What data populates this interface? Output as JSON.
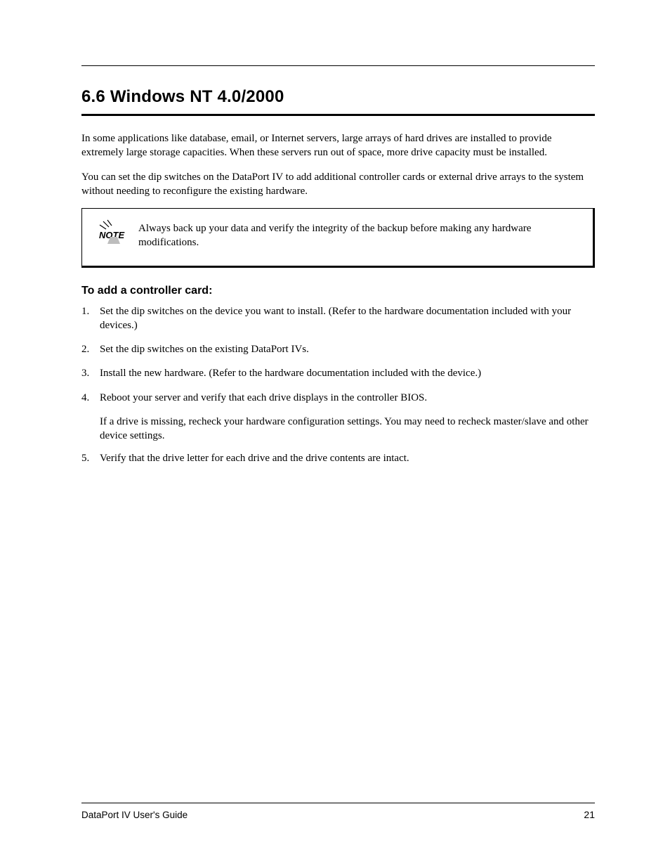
{
  "header": {
    "sectionNumber": "6.6",
    "sectionTitle": "Windows NT 4.0/2000"
  },
  "body": {
    "intro": "In some applications like database, email, or Internet servers, large arrays of hard drives are installed to provide extremely large storage capacities. When these servers run out of space, more drive capacity must be installed.",
    "intro2": "You can set the dip switches on the DataPort IV to add additional controller cards or external drive arrays to the system without needing to reconfigure the existing hardware.",
    "note": "Always back up your data and verify the integrity of the backup before making any hardware modifications.",
    "subheading": "To add a controller card:",
    "steps": [
      "Set the dip switches on the device you want to install. (Refer to the hardware documentation included with your devices.)",
      "Set the dip switches on the existing DataPort IVs.",
      "Install the new hardware. (Refer to the hardware documentation included with the device.)",
      "Reboot your server and verify that each drive displays in the controller BIOS."
    ],
    "postStep": "If a drive is missing, recheck your hardware configuration settings. You may need to recheck master/slave and other device settings.",
    "steps2": [
      "Verify that the drive letter for each drive and the drive contents are intact."
    ]
  },
  "footer": {
    "docTitle": "DataPort IV User's Guide",
    "pageNumber": "21"
  }
}
